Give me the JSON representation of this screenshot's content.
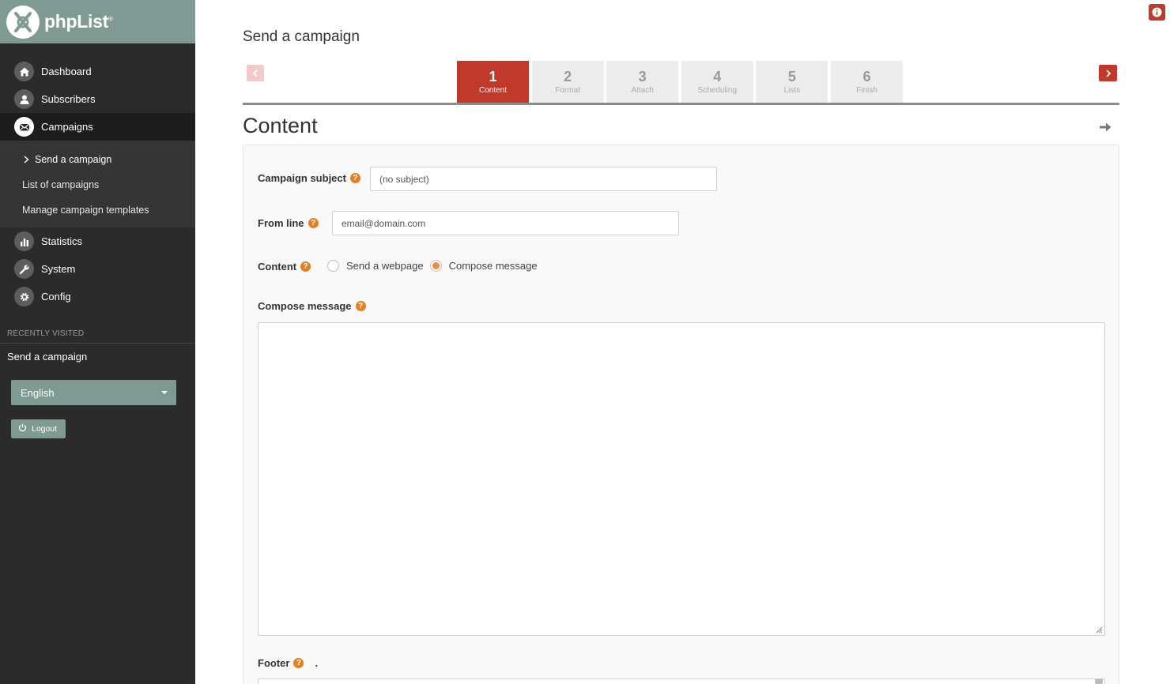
{
  "brand": {
    "name": "phpList",
    "mark": "®"
  },
  "nav": {
    "dashboard": "Dashboard",
    "subscribers": "Subscribers",
    "campaigns": "Campaigns",
    "statistics": "Statistics",
    "system": "System",
    "config": "Config"
  },
  "subnav": {
    "send": "Send a campaign",
    "list": "List of campaigns",
    "templates": "Manage campaign templates"
  },
  "recent": {
    "label": "RECENTLY VISITED",
    "item": "Send a campaign"
  },
  "language": {
    "selected": "English"
  },
  "logout": {
    "label": "Logout"
  },
  "page": {
    "title": "Send a campaign"
  },
  "steps": [
    {
      "num": "1",
      "label": "Content"
    },
    {
      "num": "2",
      "label": "Format"
    },
    {
      "num": "3",
      "label": "Attach"
    },
    {
      "num": "4",
      "label": "Scheduling"
    },
    {
      "num": "5",
      "label": "Lists"
    },
    {
      "num": "6",
      "label": "Finish"
    }
  ],
  "active_step": 1,
  "section": {
    "title": "Content"
  },
  "form": {
    "subject_label": "Campaign subject",
    "subject_value": "(no subject)",
    "from_label": "From line",
    "from_placeholder": "email@domain.com",
    "content_label": "Content",
    "radio_webpage": "Send a webpage",
    "radio_compose": "Compose message",
    "compose_label": "Compose message",
    "footer_label": "Footer",
    "footer_dot": "."
  },
  "colors": {
    "accent": "#c0392b",
    "sidebar": "#2b2b2b",
    "brand_bar": "#7f9a93",
    "help": "#e67e22"
  },
  "icons": {
    "help": "?",
    "info": "i"
  }
}
